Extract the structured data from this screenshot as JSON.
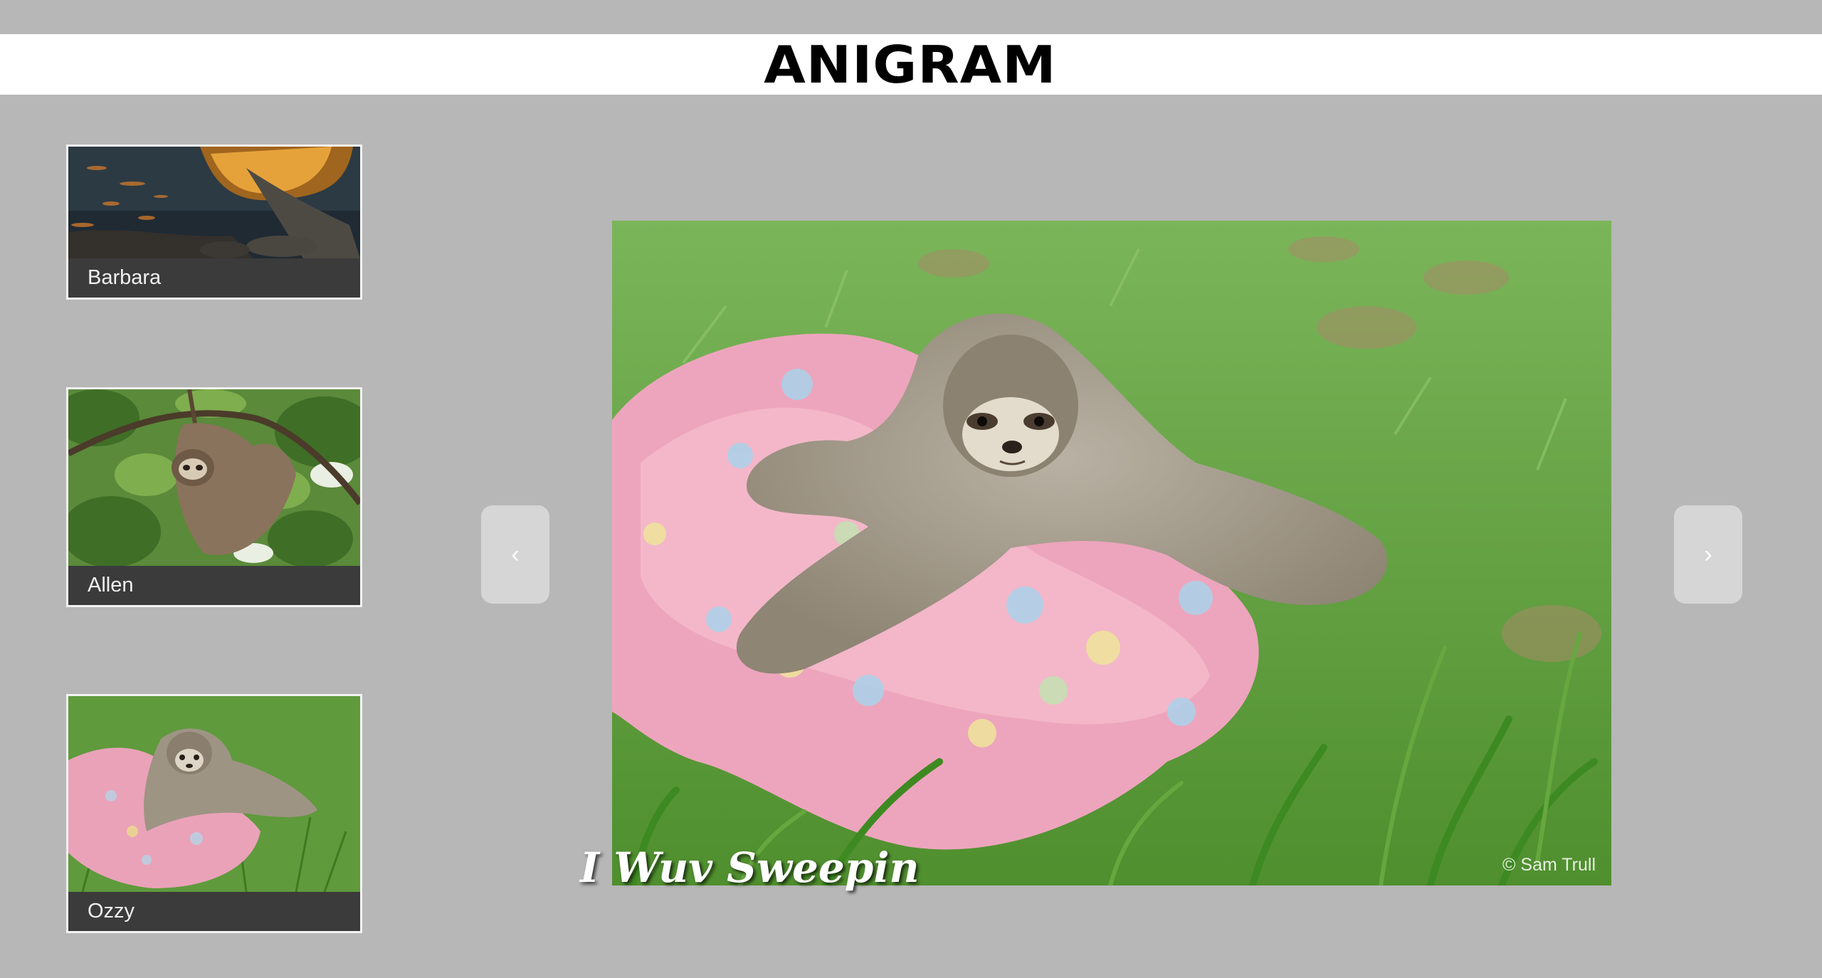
{
  "header": {
    "logo": "ANIGRAM"
  },
  "thumbnails": [
    {
      "name": "Barbara"
    },
    {
      "name": "Allen"
    },
    {
      "name": "Ozzy"
    }
  ],
  "main": {
    "caption": "I Wuv Sweepin",
    "watermark": "© Sam Trull"
  },
  "nav": {
    "prev_label": "‹",
    "next_label": "›"
  },
  "colors": {
    "background": "#b7b7b7",
    "header": "#ffffff",
    "caption_bar": "#3b3b3b",
    "nav_button": "#d6d6d6"
  }
}
